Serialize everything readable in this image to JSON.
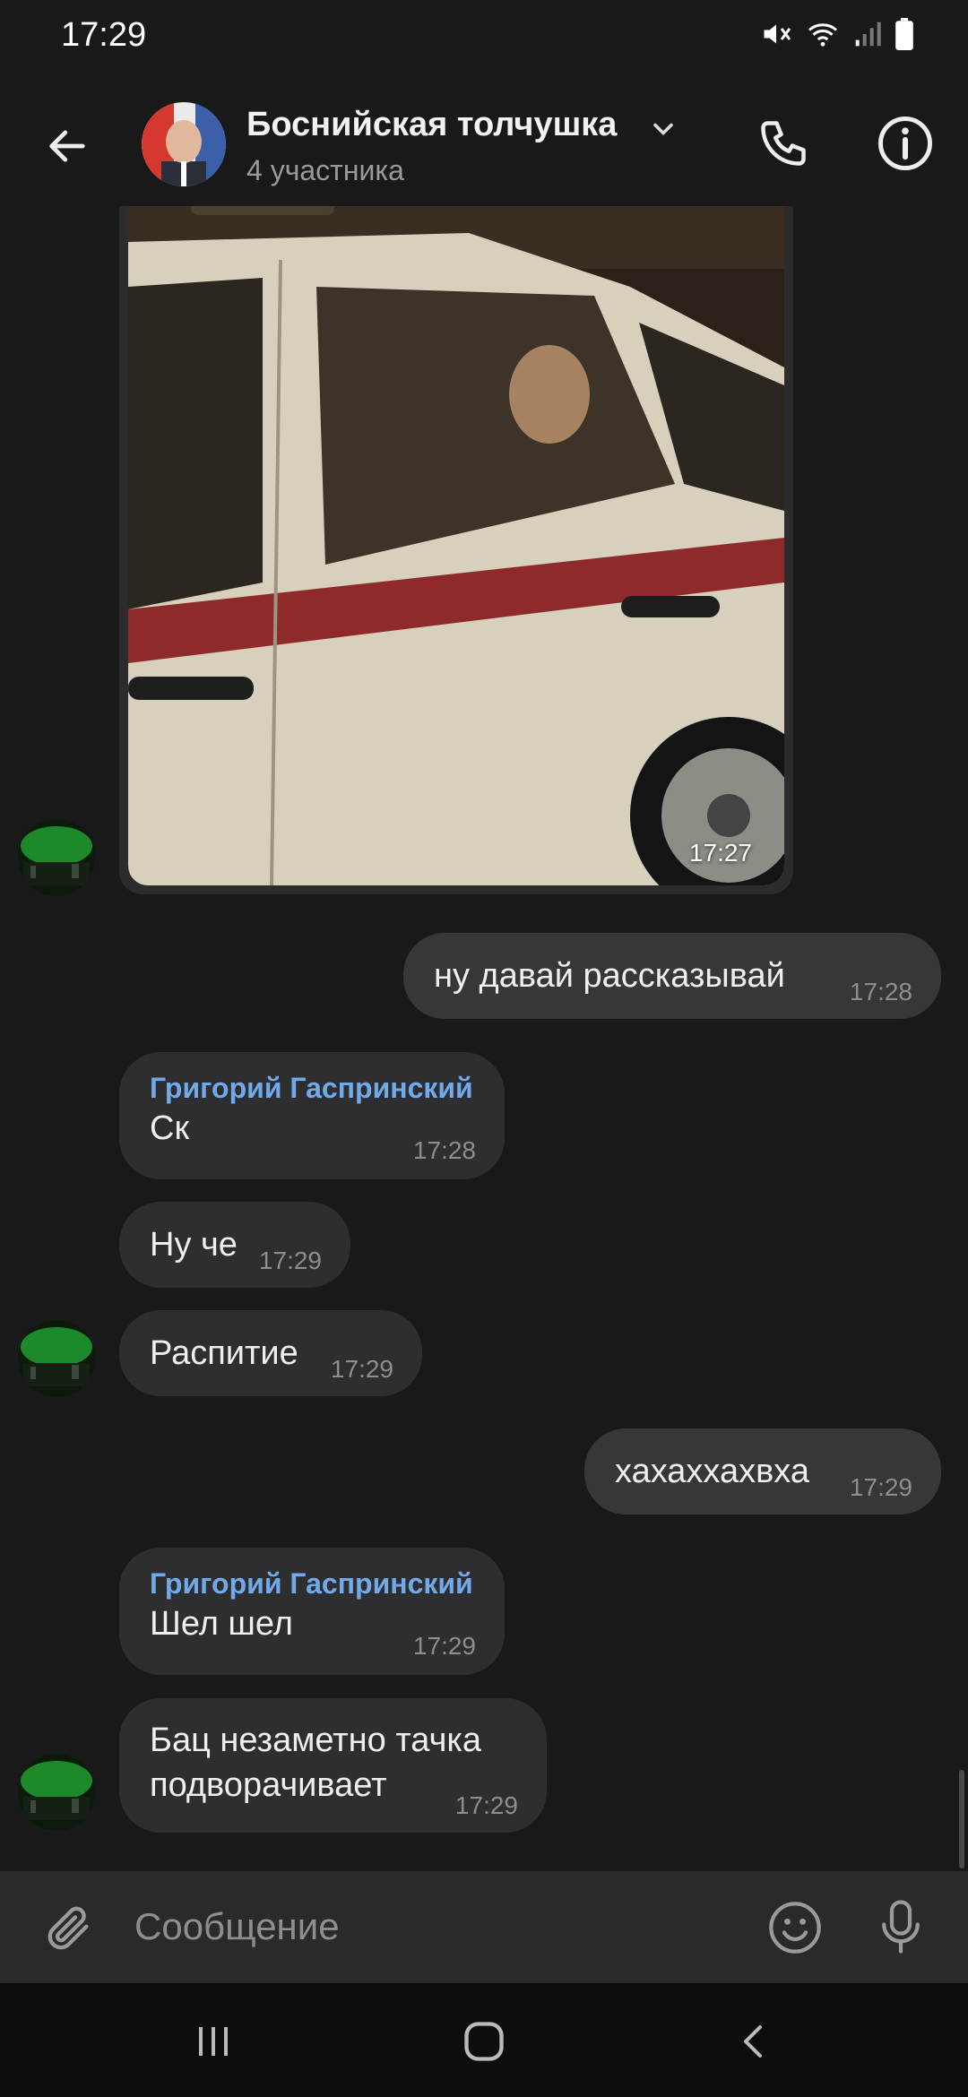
{
  "status_bar": {
    "time": "17:29"
  },
  "header": {
    "title": "Боснийская толчушка",
    "subtitle": "4 участника"
  },
  "messages": [
    {
      "type": "photo",
      "time": "17:27"
    },
    {
      "type": "text",
      "direction": "out",
      "text": "ну давай рассказывай",
      "time": "17:28"
    },
    {
      "type": "text",
      "direction": "in",
      "sender": "Григорий Гаспринский",
      "text": "Ск",
      "time": "17:28"
    },
    {
      "type": "text",
      "direction": "in",
      "text": "Ну че",
      "time": "17:29"
    },
    {
      "type": "text",
      "direction": "in",
      "text": "Распитие",
      "time": "17:29"
    },
    {
      "type": "text",
      "direction": "out",
      "text": "хахаххахвха",
      "time": "17:29"
    },
    {
      "type": "text",
      "direction": "in",
      "sender": "Григорий Гаспринский",
      "text": "Шел шел",
      "time": "17:29"
    },
    {
      "type": "text",
      "direction": "in",
      "text": "Бац незаметно тачка\nподворачивает",
      "time": "17:29"
    }
  ],
  "composer": {
    "placeholder": "Сообщение"
  },
  "colors": {
    "background": "#19191a",
    "incoming_bubble": "#2e2e30",
    "outgoing_bubble": "#373739",
    "sender_name": "#71aaeb"
  },
  "icons": {
    "back": "arrow-left-icon",
    "chevron": "chevron-down-icon",
    "call": "phone-icon",
    "info": "info-icon",
    "attach": "paperclip-icon",
    "emoji": "smiley-icon",
    "mic": "microphone-icon",
    "nav_recents": "recents-icon",
    "nav_home": "home-icon",
    "nav_back": "nav-back-icon"
  }
}
